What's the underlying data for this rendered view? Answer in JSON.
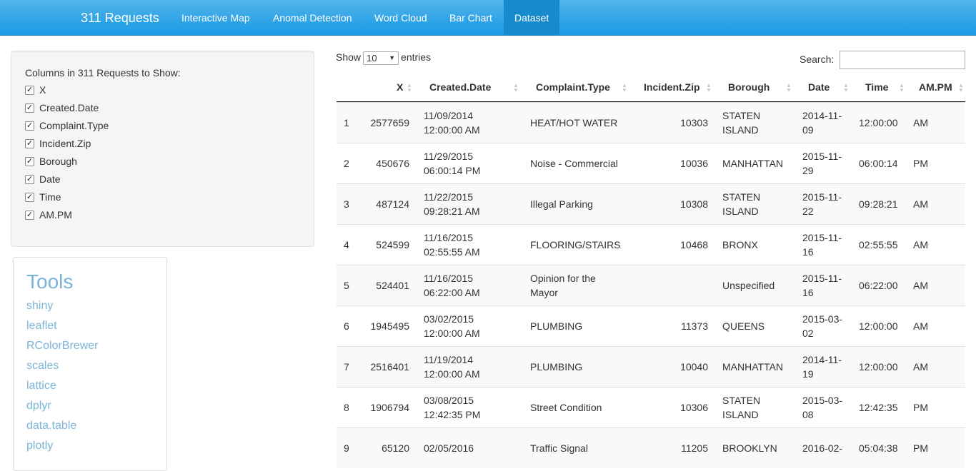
{
  "navbar": {
    "brand": "311 Requests",
    "tabs": [
      {
        "label": "Interactive Map"
      },
      {
        "label": "Anomal Detection"
      },
      {
        "label": "Word Cloud"
      },
      {
        "label": "Bar Chart"
      },
      {
        "label": "Dataset",
        "active": true
      }
    ]
  },
  "sidebar": {
    "title": "Columns in 311 Requests to Show:",
    "columns": [
      "X",
      "Created.Date",
      "Complaint.Type",
      "Incident.Zip",
      "Borough",
      "Date",
      "Time",
      "AM.PM"
    ]
  },
  "tools": {
    "title": "Tools",
    "links": [
      "shiny",
      "leaflet",
      "RColorBrewer",
      "scales",
      "lattice",
      "dplyr",
      "data.table",
      "plotly"
    ]
  },
  "table": {
    "show_label": "Show",
    "entries_value": "10",
    "entries_label": "entries",
    "search_label": "Search:",
    "headers": [
      "",
      "X",
      "Created.Date",
      "Complaint.Type",
      "Incident.Zip",
      "Borough",
      "Date",
      "Time",
      "AM.PM"
    ],
    "rows": [
      {
        "idx": "1",
        "x": "2577659",
        "created1": "11/09/2014",
        "created2": "12:00:00 AM",
        "type1": "HEAT/HOT WATER",
        "type2": "",
        "zip": "10303",
        "boro1": "STATEN",
        "boro2": "ISLAND",
        "date1": "2014-11-",
        "date2": "09",
        "time": "12:00:00",
        "ampm": "AM"
      },
      {
        "idx": "2",
        "x": "450676",
        "created1": "11/29/2015",
        "created2": "06:00:14 PM",
        "type1": "Noise - Commercial",
        "type2": "",
        "zip": "10036",
        "boro1": "MANHATTAN",
        "boro2": "",
        "date1": "2015-11-",
        "date2": "29",
        "time": "06:00:14",
        "ampm": "PM"
      },
      {
        "idx": "3",
        "x": "487124",
        "created1": "11/22/2015",
        "created2": "09:28:21 AM",
        "type1": "Illegal Parking",
        "type2": "",
        "zip": "10308",
        "boro1": "STATEN",
        "boro2": "ISLAND",
        "date1": "2015-11-",
        "date2": "22",
        "time": "09:28:21",
        "ampm": "AM"
      },
      {
        "idx": "4",
        "x": "524599",
        "created1": "11/16/2015",
        "created2": "02:55:55 AM",
        "type1": "FLOORING/STAIRS",
        "type2": "",
        "zip": "10468",
        "boro1": "BRONX",
        "boro2": "",
        "date1": "2015-11-",
        "date2": "16",
        "time": "02:55:55",
        "ampm": "AM"
      },
      {
        "idx": "5",
        "x": "524401",
        "created1": "11/16/2015",
        "created2": "06:22:00 AM",
        "type1": "Opinion for the",
        "type2": "Mayor",
        "zip": "",
        "boro1": "Unspecified",
        "boro2": "",
        "date1": "2015-11-",
        "date2": "16",
        "time": "06:22:00",
        "ampm": "AM"
      },
      {
        "idx": "6",
        "x": "1945495",
        "created1": "03/02/2015",
        "created2": "12:00:00 AM",
        "type1": "PLUMBING",
        "type2": "",
        "zip": "11373",
        "boro1": "QUEENS",
        "boro2": "",
        "date1": "2015-03-",
        "date2": "02",
        "time": "12:00:00",
        "ampm": "AM"
      },
      {
        "idx": "7",
        "x": "2516401",
        "created1": "11/19/2014",
        "created2": "12:00:00 AM",
        "type1": "PLUMBING",
        "type2": "",
        "zip": "10040",
        "boro1": "MANHATTAN",
        "boro2": "",
        "date1": "2014-11-",
        "date2": "19",
        "time": "12:00:00",
        "ampm": "AM"
      },
      {
        "idx": "8",
        "x": "1906794",
        "created1": "03/08/2015",
        "created2": "12:42:35 PM",
        "type1": "Street Condition",
        "type2": "",
        "zip": "10306",
        "boro1": "STATEN",
        "boro2": "ISLAND",
        "date1": "2015-03-",
        "date2": "08",
        "time": "12:42:35",
        "ampm": "PM"
      },
      {
        "idx": "9",
        "x": "65120",
        "created1": "02/05/2016",
        "created2": "",
        "type1": "Traffic Signal",
        "type2": "",
        "zip": "11205",
        "boro1": "BROOKLYN",
        "boro2": "",
        "date1": "2016-02-",
        "date2": "",
        "time": "05:04:38",
        "ampm": "PM"
      }
    ]
  }
}
